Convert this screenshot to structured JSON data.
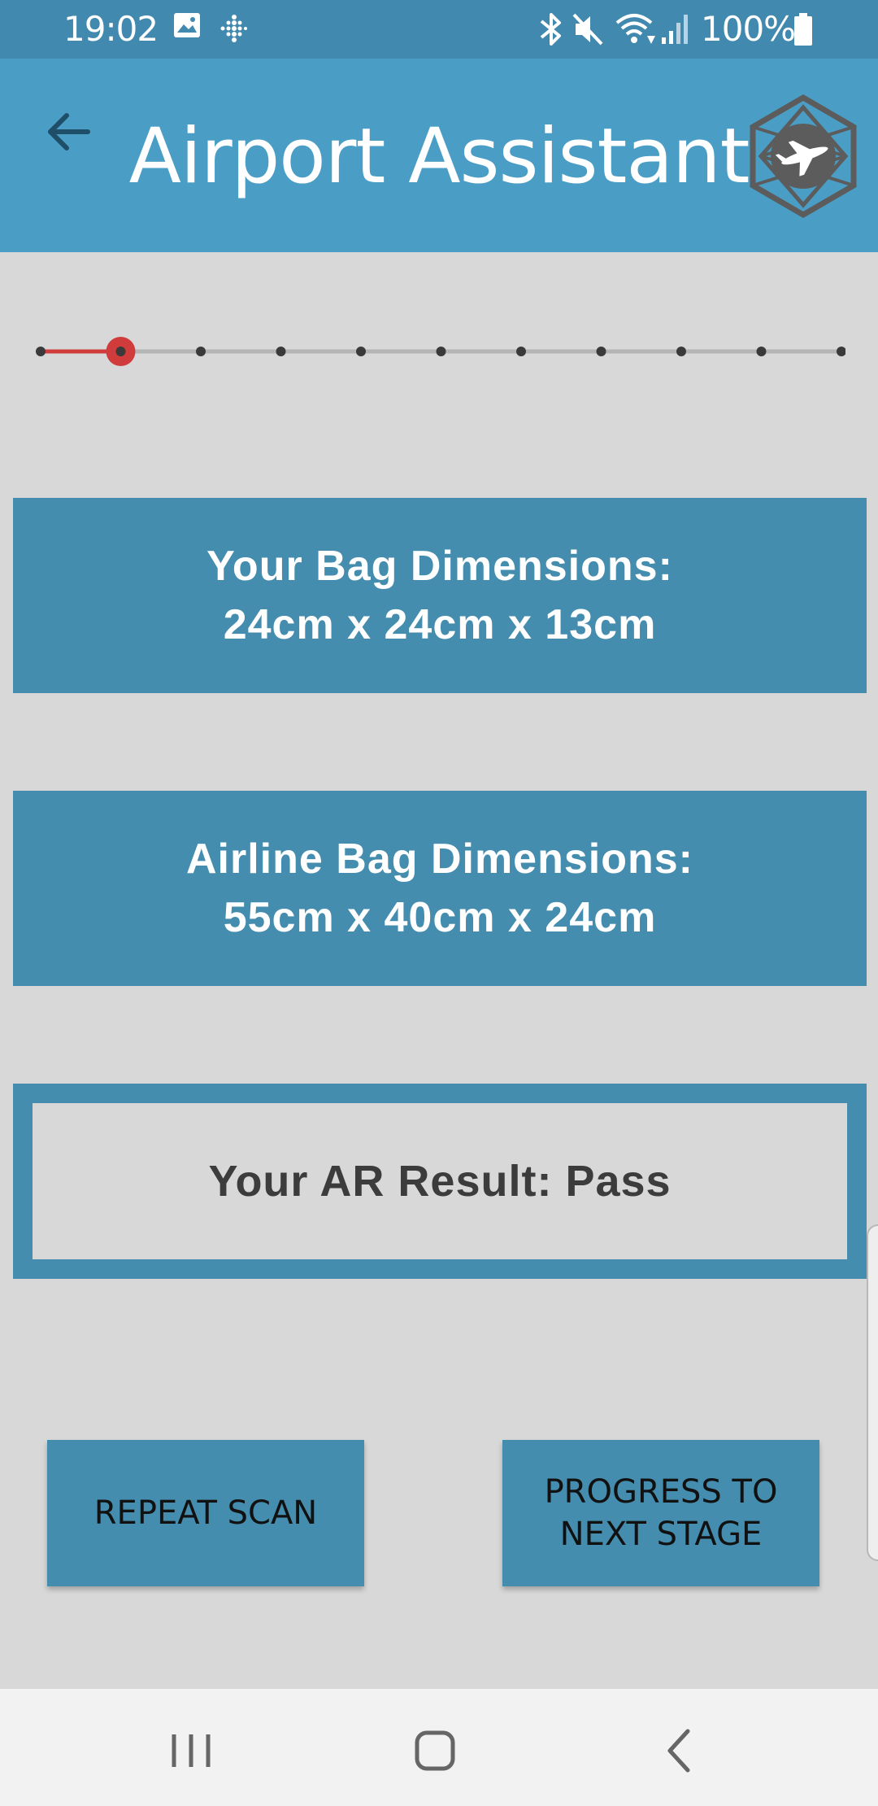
{
  "status_bar": {
    "time": "19:02",
    "battery_text": "100%",
    "icons": [
      "gallery-icon",
      "fitbit-icon",
      "bluetooth-icon",
      "mute-icon",
      "wifi-icon",
      "signal-icon",
      "battery-icon"
    ]
  },
  "app_bar": {
    "title": "Airport Assistant",
    "back_icon": "arrow-back-icon",
    "logo_icon": "airplane-hexagon-logo-icon"
  },
  "stepper": {
    "total_steps": 11,
    "current_step": 2,
    "active_color": "#d03b3b",
    "inactive_color": "#aaaaaa"
  },
  "your_bag": {
    "label": "Your Bag Dimensions:",
    "value": "24cm x 24cm x 13cm"
  },
  "airline_bag": {
    "label": "Airline Bag Dimensions:",
    "value": "55cm x 40cm x 24cm"
  },
  "result": {
    "text": "Your AR Result: Pass"
  },
  "buttons": {
    "repeat_scan": "REPEAT SCAN",
    "progress_next": "PROGRESS TO NEXT STAGE"
  },
  "nav_bar": {
    "icons": [
      "recent-apps-icon",
      "home-icon",
      "back-icon"
    ]
  },
  "colors": {
    "status_bar": "#4189ae",
    "app_bar": "#4a9ec6",
    "panel": "#458dae",
    "background": "#d8d8d8"
  }
}
